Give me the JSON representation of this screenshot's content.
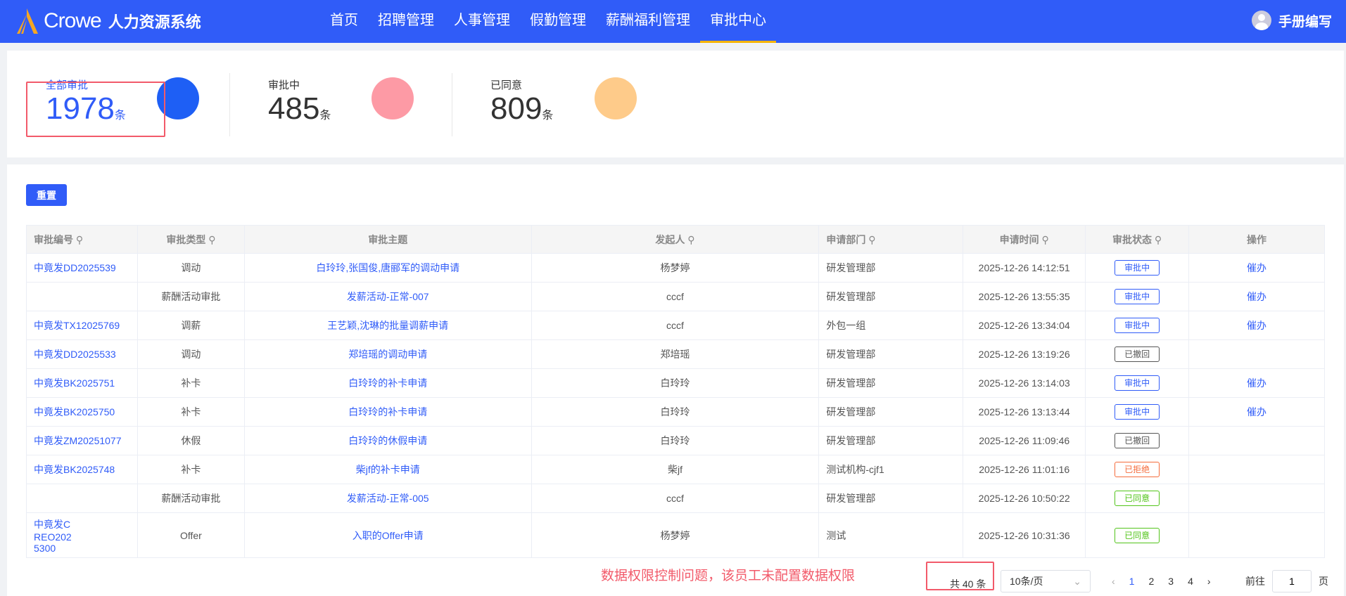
{
  "header": {
    "brand": "Crowe",
    "system": "人力资源系统",
    "nav": [
      "首页",
      "招聘管理",
      "人事管理",
      "假勤管理",
      "薪酬福利管理",
      "审批中心"
    ],
    "active": "审批中心",
    "user": "手册编写"
  },
  "stats": [
    {
      "label": "全部审批",
      "value": "1978",
      "unit": "条",
      "color": "#1e5ff5"
    },
    {
      "label": "审批中",
      "value": "485",
      "unit": "条",
      "color": "#fd9aa5"
    },
    {
      "label": "已同意",
      "value": "809",
      "unit": "条",
      "color": "#fecb8a"
    }
  ],
  "toolbar": {
    "reset": "重置"
  },
  "table": {
    "headers": [
      "审批编号",
      "审批类型",
      "审批主题",
      "发起人",
      "申请部门",
      "申请时间",
      "审批状态",
      "操作"
    ],
    "rows": [
      [
        "中竟发DD2025539",
        "调动",
        "白玲玲,张国俊,唐郦军的调动申请",
        "杨梦婷",
        "研发管理部",
        "2025-12-26 14:12:51",
        "审批中",
        "催办"
      ],
      [
        "",
        "薪酬活动审批",
        "发薪活动-正常-007",
        "cccf",
        "研发管理部",
        "2025-12-26 13:55:35",
        "审批中",
        "催办"
      ],
      [
        "中竟发TX12025769",
        "调薪",
        "王艺颖,沈琳的批量调薪申请",
        "cccf",
        "外包一组",
        "2025-12-26 13:34:04",
        "审批中",
        "催办"
      ],
      [
        "中竟发DD2025533",
        "调动",
        "郑培瑶的调动申请",
        "郑培瑶",
        "研发管理部",
        "2025-12-26 13:19:26",
        "已撤回",
        ""
      ],
      [
        "中竟发BK2025751",
        "补卡",
        "白玲玲的补卡申请",
        "白玲玲",
        "研发管理部",
        "2025-12-26 13:14:03",
        "审批中",
        "催办"
      ],
      [
        "中竟发BK2025750",
        "补卡",
        "白玲玲的补卡申请",
        "白玲玲",
        "研发管理部",
        "2025-12-26 13:13:44",
        "审批中",
        "催办"
      ],
      [
        "中竟发ZM20251077",
        "休假",
        "白玲玲的休假申请",
        "白玲玲",
        "研发管理部",
        "2025-12-26 11:09:46",
        "已撤回",
        ""
      ],
      [
        "中竟发BK2025748",
        "补卡",
        "柴jf的补卡申请",
        "柴jf",
        "测试机构-cjf1",
        "2025-12-26 11:01:16",
        "已拒绝",
        ""
      ],
      [
        "",
        "薪酬活动审批",
        "发薪活动-正常-005",
        "cccf",
        "研发管理部",
        "2025-12-26 10:50:22",
        "已同意",
        ""
      ],
      [
        "中竟发CREO2025300",
        "Offer",
        "入职的Offer申请",
        "杨梦婷",
        "测试",
        "2025-12-26 10:31:36",
        "已同意",
        ""
      ]
    ]
  },
  "status_colors": {
    "审批中": "#305cf8",
    "已撤回": "#555555",
    "已拒绝": "#f56c3c",
    "已同意": "#52c41a"
  },
  "annotation": "数据权限控制问题，该员工未配置数据权限",
  "pagination": {
    "total": "共 40 条",
    "page_size": "10条/页",
    "pages": [
      "1",
      "2",
      "3",
      "4"
    ],
    "current": "1",
    "goto_label": "前往",
    "goto_value": "1",
    "page_suffix": "页"
  }
}
